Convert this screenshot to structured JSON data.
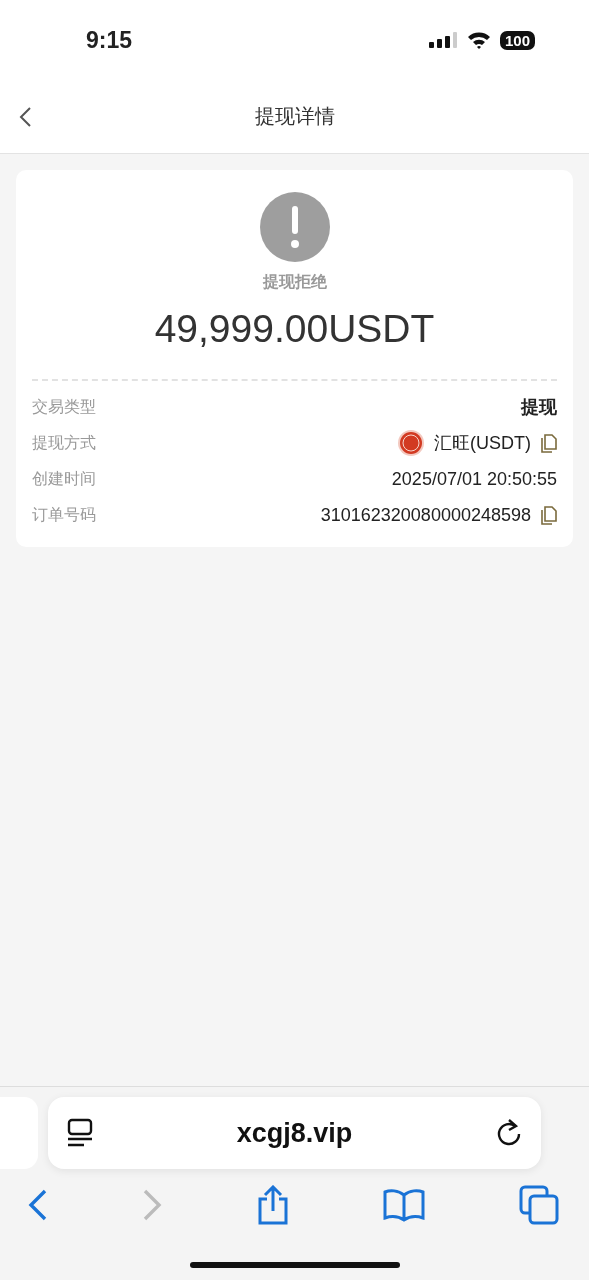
{
  "status_bar": {
    "time": "9:15",
    "battery": "100"
  },
  "nav": {
    "title": "提现详情"
  },
  "card": {
    "status": "提现拒绝",
    "amount": "49,999.00USDT",
    "rows": [
      {
        "label": "交易类型",
        "value": "提现",
        "kind": "strong",
        "copyable": false
      },
      {
        "label": "提现方式",
        "value": "汇旺(USDT)",
        "kind": "method",
        "copyable": true
      },
      {
        "label": "创建时间",
        "value": "2025/07/01 20:50:55",
        "kind": "text",
        "copyable": false
      },
      {
        "label": "订单号码",
        "value": "310162320080000248598",
        "kind": "text",
        "copyable": true
      }
    ]
  },
  "browser": {
    "url": "xcgj8.vip",
    "back_disabled": false,
    "forward_disabled": true
  }
}
